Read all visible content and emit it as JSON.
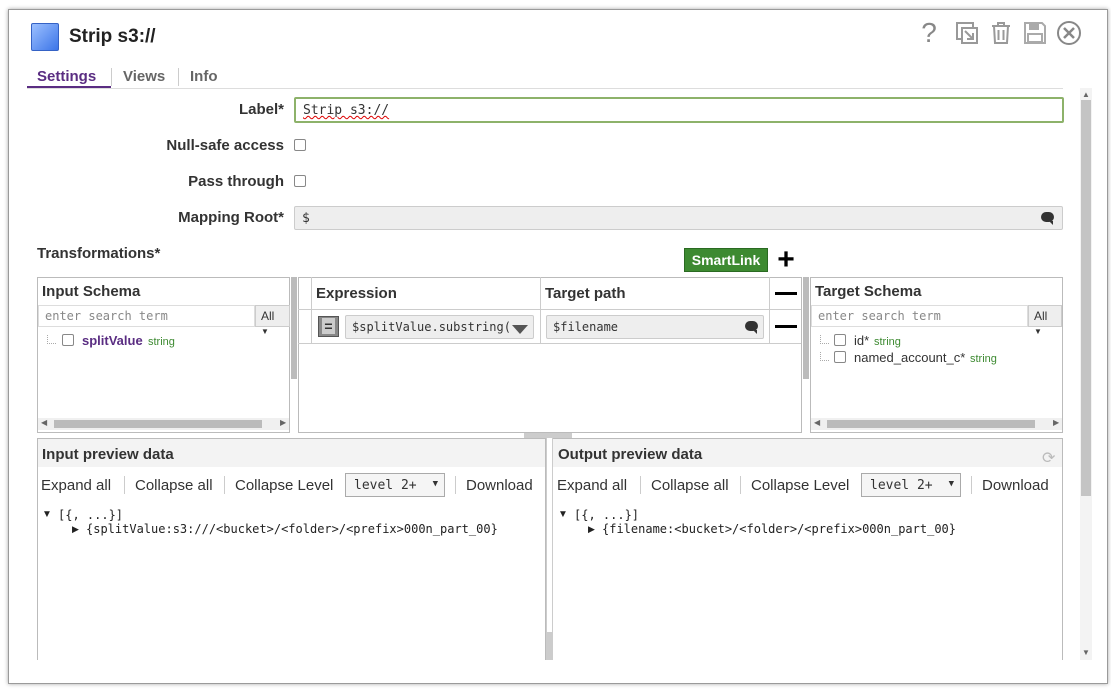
{
  "dialog": {
    "title": "Strip s3://"
  },
  "tabs": [
    {
      "label": "Settings"
    },
    {
      "label": "Views"
    },
    {
      "label": "Info"
    }
  ],
  "settings": {
    "label_label": "Label*",
    "label_value": "Strip s3://",
    "null_safe_label": "Null-safe access",
    "pass_through_label": "Pass through",
    "mapping_root_label": "Mapping Root*",
    "mapping_root_value": "$"
  },
  "transformations": {
    "label": "Transformations*",
    "smartlink_label": "SmartLink",
    "input_schema": {
      "title": "Input Schema",
      "search_placeholder": "enter search term",
      "filter": "All",
      "fields": [
        {
          "name": "splitValue",
          "type": "string"
        }
      ]
    },
    "mapping": {
      "expression_header": "Expression",
      "target_header": "Target path",
      "rows": [
        {
          "op": "=",
          "expression": "$splitValue.substring(",
          "target": "$filename"
        }
      ]
    },
    "target_schema": {
      "title": "Target Schema",
      "search_placeholder": "enter search term",
      "filter": "All",
      "fields": [
        {
          "name": "id*",
          "type": "string"
        },
        {
          "name": "named_account_c*",
          "type": "string"
        }
      ]
    }
  },
  "input_preview": {
    "title": "Input preview data",
    "expand_all": "Expand all",
    "collapse_all": "Collapse all",
    "collapse_level": "Collapse Level",
    "level": "level 2+",
    "download": "Download",
    "root": "[{, ...}]",
    "child": "{splitValue:s3:///<bucket>/<folder>/<prefix>000n_part_00}"
  },
  "output_preview": {
    "title": "Output preview data",
    "expand_all": "Expand all",
    "collapse_all": "Collapse all",
    "collapse_level": "Collapse Level",
    "level": "level 2+",
    "download": "Download",
    "root": "[{, ...}]",
    "child": "{filename:<bucket>/<folder>/<prefix>000n_part_00}"
  }
}
